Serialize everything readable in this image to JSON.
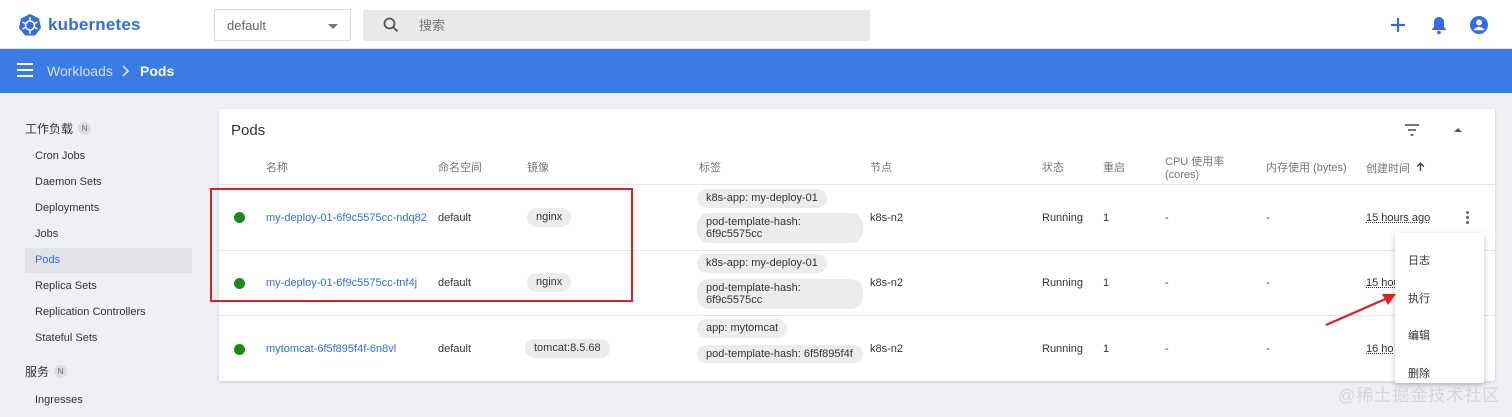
{
  "app": {
    "name": "kubernetes"
  },
  "namespace": {
    "selected": "default"
  },
  "search": {
    "placeholder": "搜索"
  },
  "breadcrumb": {
    "parent": "Workloads",
    "current": "Pods"
  },
  "sidebar": {
    "sections": [
      {
        "label": "工作负载",
        "badge": "N"
      },
      {
        "label": "服务",
        "badge": "N"
      }
    ],
    "workload_items": [
      "Cron Jobs",
      "Daemon Sets",
      "Deployments",
      "Jobs",
      "Pods",
      "Replica Sets",
      "Replication Controllers",
      "Stateful Sets"
    ],
    "service_items": [
      "Ingresses"
    ],
    "active": "Pods"
  },
  "card": {
    "title": "Pods",
    "columns": [
      "名称",
      "命名空间",
      "镜像",
      "标签",
      "节点",
      "状态",
      "重启",
      "CPU 使用率",
      "(cores)",
      "内存使用 (bytes)",
      "创建时间"
    ],
    "rows": [
      {
        "name": "my-deploy-01-6f9c5575cc-ndq82",
        "namespace": "default",
        "image": "nginx",
        "label1": "k8s-app: my-deploy-01",
        "label2": "pod-template-hash: 6f9c5575cc",
        "node": "k8s-n2",
        "status": "Running",
        "restarts": "1",
        "cpu": "-",
        "memory": "-",
        "created": "15 hours ago"
      },
      {
        "name": "my-deploy-01-6f9c5575cc-tnf4j",
        "namespace": "default",
        "image": "nginx",
        "label1": "k8s-app: my-deploy-01",
        "label2": "pod-template-hash: 6f9c5575cc",
        "node": "k8s-n2",
        "status": "Running",
        "restarts": "1",
        "cpu": "-",
        "memory": "-",
        "created": "15 hou"
      },
      {
        "name": "mytomcat-6f5f895f4f-6n8vl",
        "namespace": "default",
        "image": "tomcat:8.5.68",
        "label1": "app: mytomcat",
        "label2": "pod-template-hash: 6f5f895f4f",
        "node": "k8s-n2",
        "status": "Running",
        "restarts": "1",
        "cpu": "-",
        "memory": "-",
        "created": "16 ho"
      }
    ]
  },
  "context_menu": {
    "items": [
      "日志",
      "执行",
      "编辑",
      "删除"
    ]
  },
  "watermark": "@稀土掘金技术社区",
  "colors": {
    "brand": "#326ce5",
    "appbar": "#3a7be6",
    "running": "#1a8a1a",
    "highlight": "#e02020"
  }
}
